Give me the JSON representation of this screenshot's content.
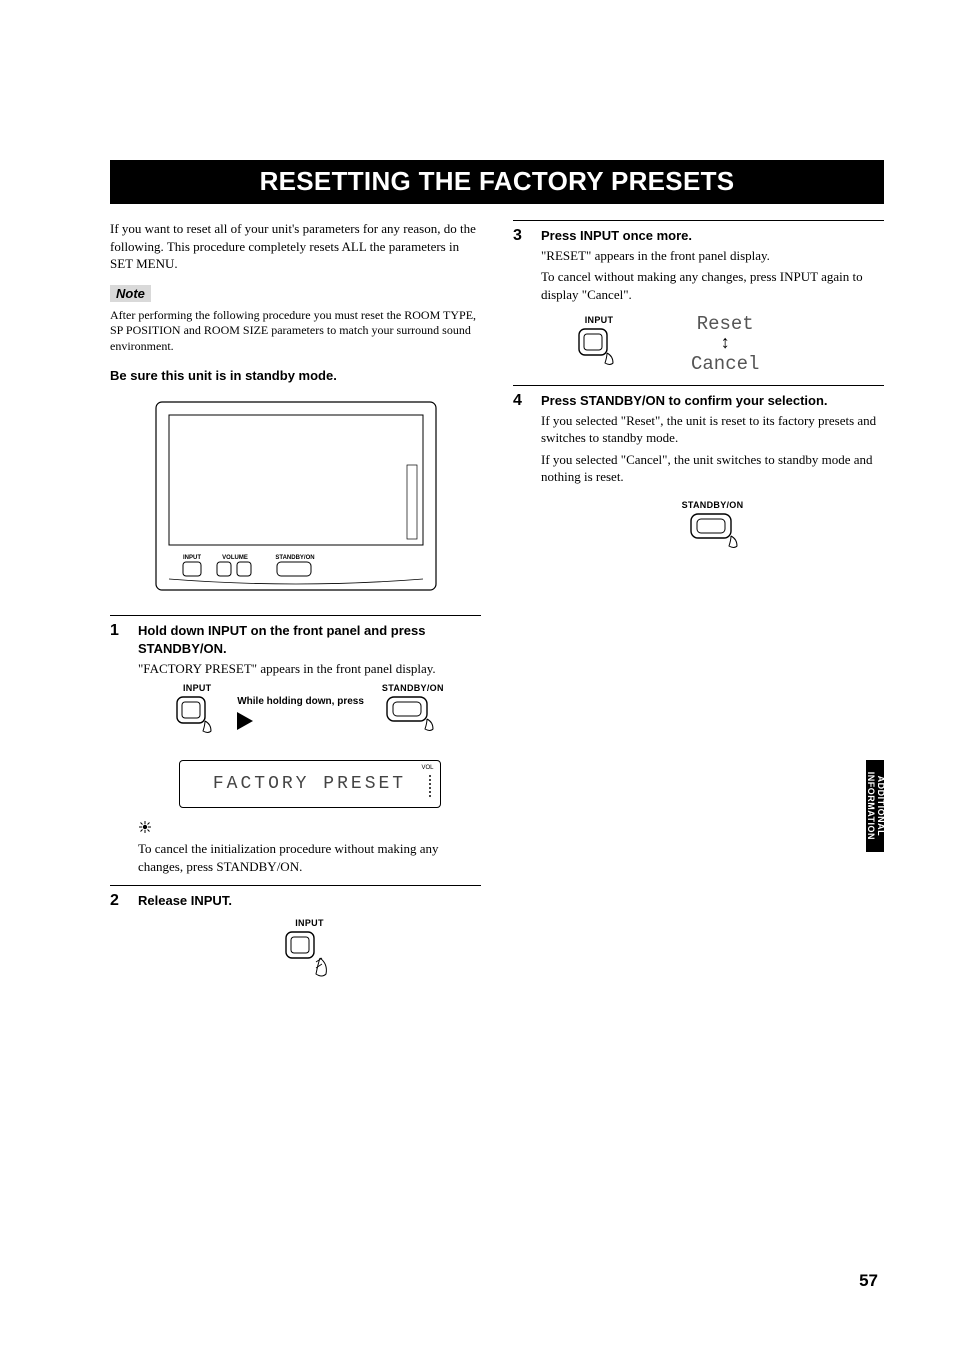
{
  "page_title": "RESETTING THE FACTORY PRESETS",
  "intro": "If you want to reset all of your unit's parameters for any reason, do the following. This procedure completely resets ALL the parameters in SET MENU.",
  "note_label": "Note",
  "note_text": "After performing the following procedure you must reset the ROOM TYPE, SP POSITION and ROOM SIZE parameters to match your surround sound environment.",
  "standby_warning": "Be sure this unit is in standby mode.",
  "panel": {
    "input": "INPUT",
    "volume": "VOLUME",
    "standby": "STANDBY/ON"
  },
  "steps": {
    "s1": {
      "num": "1",
      "head": "Hold down INPUT on the front panel and press STANDBY/ON.",
      "text": "\"FACTORY PRESET\" appears in the front panel display.",
      "hold_label": "While holding down, press",
      "input_label": "INPUT",
      "standby_label": "STANDBY/ON",
      "lcd": "FACTORY PRESET",
      "vol_label": "VOL",
      "tip": "To cancel the initialization procedure without making any changes, press STANDBY/ON."
    },
    "s2": {
      "num": "2",
      "head": "Release INPUT.",
      "input_label": "INPUT"
    },
    "s3": {
      "num": "3",
      "head": "Press INPUT once more.",
      "text1": "\"RESET\" appears in the front panel display.",
      "text2": "To cancel without making any changes, press INPUT again to display \"Cancel\".",
      "input_label": "INPUT",
      "reset": "Reset",
      "cancel": "Cancel"
    },
    "s4": {
      "num": "4",
      "head": "Press STANDBY/ON to confirm your selection.",
      "text1": "If you selected \"Reset\", the unit is reset to its factory presets and switches to standby mode.",
      "text2": "If you selected \"Cancel\", the unit switches to standby mode and nothing is reset.",
      "standby_label": "STANDBY/ON"
    }
  },
  "side_tab_line1": "ADDITIONAL",
  "side_tab_line2": "INFORMATION",
  "page_number": "57"
}
